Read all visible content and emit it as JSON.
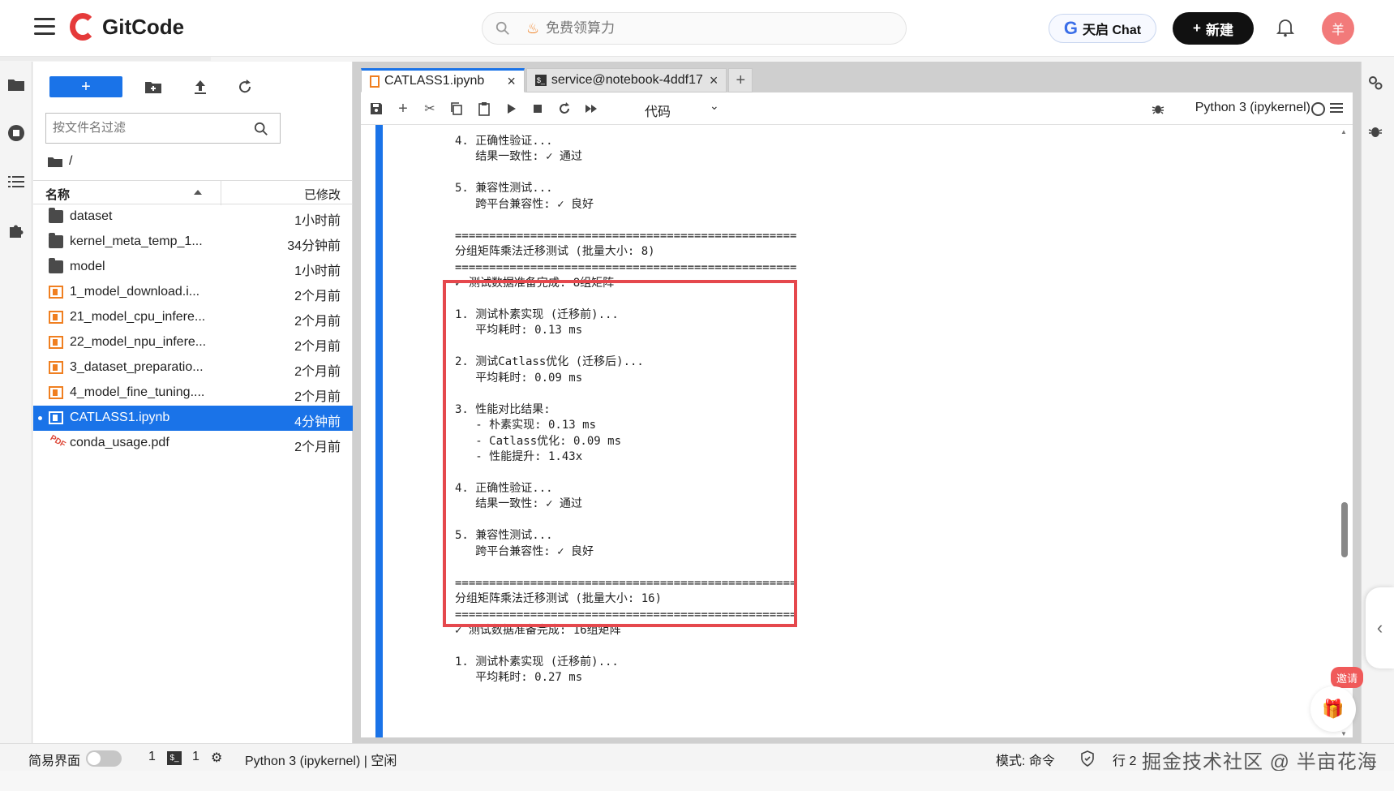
{
  "header": {
    "brand": "GitCode",
    "search_placeholder": "免费领算力",
    "chat_label": "天启 Chat",
    "new_label": "新建",
    "avatar_text": "羊"
  },
  "file_browser": {
    "filter_placeholder": "按文件名过滤",
    "breadcrumb": "/",
    "col_name": "名称",
    "col_modified": "已修改",
    "items": [
      {
        "name": "dataset",
        "modified": "1小时前",
        "type": "folder"
      },
      {
        "name": "kernel_meta_temp_1...",
        "modified": "34分钟前",
        "type": "folder"
      },
      {
        "name": "model",
        "modified": "1小时前",
        "type": "folder"
      },
      {
        "name": "1_model_download.i...",
        "modified": "2个月前",
        "type": "notebook"
      },
      {
        "name": "21_model_cpu_infere...",
        "modified": "2个月前",
        "type": "notebook"
      },
      {
        "name": "22_model_npu_infere...",
        "modified": "2个月前",
        "type": "notebook"
      },
      {
        "name": "3_dataset_preparatio...",
        "modified": "2个月前",
        "type": "notebook"
      },
      {
        "name": "4_model_fine_tuning....",
        "modified": "2个月前",
        "type": "notebook"
      },
      {
        "name": "CATLASS1.ipynb",
        "modified": "4分钟前",
        "type": "notebook",
        "selected": true
      },
      {
        "name": "conda_usage.pdf",
        "modified": "2个月前",
        "type": "pdf"
      }
    ]
  },
  "tabs": [
    {
      "label": "CATLASS1.ipynb",
      "close": "×"
    },
    {
      "label": "service@notebook-4ddf17",
      "close": "×"
    }
  ],
  "toolbar": {
    "cell_type": "代码",
    "kernel": "Python 3 (ipykernel)"
  },
  "output_lines": [
    "4. 正确性验证...",
    "   结果一致性: ✓ 通过",
    "",
    "5. 兼容性测试...",
    "   跨平台兼容性: ✓ 良好",
    "",
    "==================================================",
    "分组矩阵乘法迁移测试 (批量大小: 8)",
    "==================================================",
    "✓ 测试数据准备完成: 8组矩阵",
    "",
    "1. 测试朴素实现 (迁移前)...",
    "   平均耗时: 0.13 ms",
    "",
    "2. 测试Catlass优化 (迁移后)...",
    "   平均耗时: 0.09 ms",
    "",
    "3. 性能对比结果:",
    "   - 朴素实现: 0.13 ms",
    "   - Catlass优化: 0.09 ms",
    "   - 性能提升: 1.43x",
    "",
    "4. 正确性验证...",
    "   结果一致性: ✓ 通过",
    "",
    "5. 兼容性测试...",
    "   跨平台兼容性: ✓ 良好",
    "",
    "==================================================",
    "分组矩阵乘法迁移测试 (批量大小: 16)",
    "==================================================",
    "✓ 测试数据准备完成: 16组矩阵",
    "",
    "1. 测试朴素实现 (迁移前)...",
    "   平均耗时: 0.27 ms"
  ],
  "statusbar": {
    "simple_mode": "简易界面",
    "count1": "1",
    "count2": "1",
    "kernel_status": "Python 3 (ipykernel) | 空闲",
    "mode": "模式: 命令",
    "position_prefix": "行 2"
  },
  "overlay": {
    "invite": "邀请",
    "watermark": "掘金技术社区 @ 半亩花海"
  },
  "colors": {
    "accent": "#1a73e8",
    "highlight_border": "#e5484d",
    "notebook_icon": "#f07f20"
  }
}
